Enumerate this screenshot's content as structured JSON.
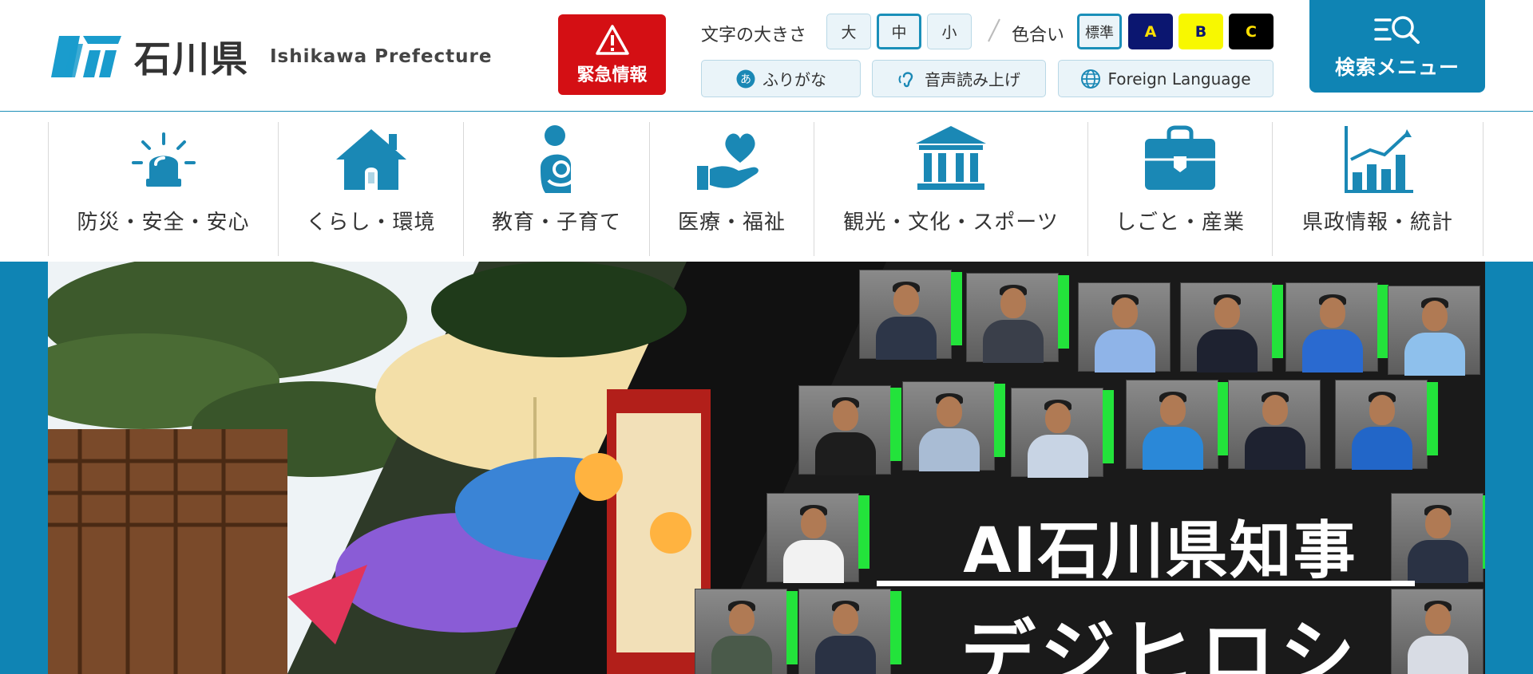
{
  "header": {
    "logo_jp": "石川県",
    "logo_en": "Ishikawa Prefecture",
    "emergency_label": "緊急情報",
    "font_size_label": "文字の大きさ",
    "font_sizes": [
      "大",
      "中",
      "小"
    ],
    "font_size_selected": "中",
    "color_label": "色合い",
    "color_options": [
      "標準",
      "A",
      "B",
      "C"
    ],
    "color_selected": "標準",
    "furigana_label": "ふりがな",
    "furigana_icon_char": "あ",
    "read_aloud_label": "音声読み上げ",
    "foreign_language_label": "Foreign Language",
    "search_menu_label": "検索メニュー",
    "colors": {
      "brand_blue": "#0f84b4",
      "emergency_red": "#d40f14",
      "theme_a_bg": "#0b1670",
      "theme_b_bg": "#f8f800",
      "theme_c_bg": "#000000",
      "highlight_yellow": "#ffe000"
    }
  },
  "nav": {
    "items": [
      {
        "label": "防災・安全・安心",
        "icon": "siren-icon"
      },
      {
        "label": "くらし・環境",
        "icon": "house-icon"
      },
      {
        "label": "教育・子育て",
        "icon": "parent-child-icon"
      },
      {
        "label": "医療・福祉",
        "icon": "heart-hand-icon"
      },
      {
        "label": "観光・文化・スポーツ",
        "icon": "museum-icon"
      },
      {
        "label": "しごと・産業",
        "icon": "briefcase-icon"
      },
      {
        "label": "県政情報・統計",
        "icon": "bar-chart-icon"
      }
    ],
    "icon_color": "#1a88b5"
  },
  "hero": {
    "title": "AI石川県知事",
    "subtitle": "デジヒロシ"
  }
}
